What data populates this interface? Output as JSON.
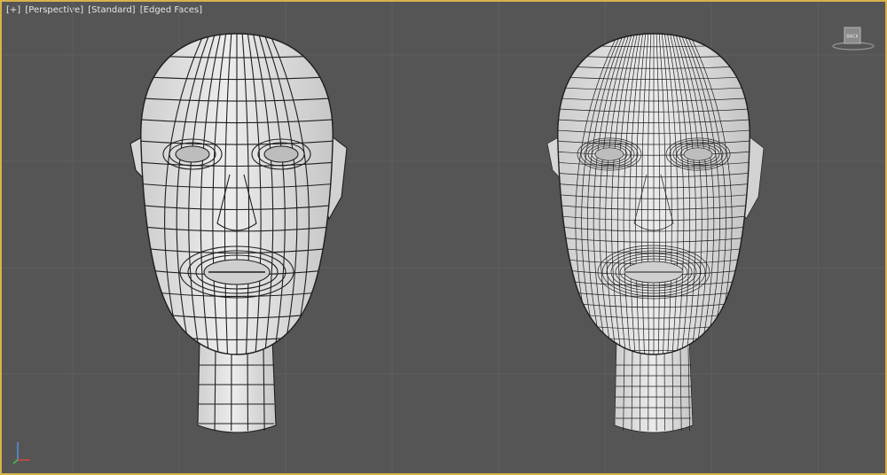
{
  "viewport": {
    "menu": {
      "plus": "[+]",
      "view": "[Perspective]",
      "shading": "[Standard]",
      "display": "[Edged Faces]"
    },
    "viewcube_label": "BACK",
    "colors": {
      "background": "#555555",
      "active_border": "#d8b24a",
      "mesh_fill": "#e0e0e0",
      "wire": "#1e1e1e"
    }
  },
  "objects": [
    {
      "name": "head-low-poly",
      "icon": "head-mesh-low-poly"
    },
    {
      "name": "head-subdivided",
      "icon": "head-mesh-subdivided"
    }
  ]
}
